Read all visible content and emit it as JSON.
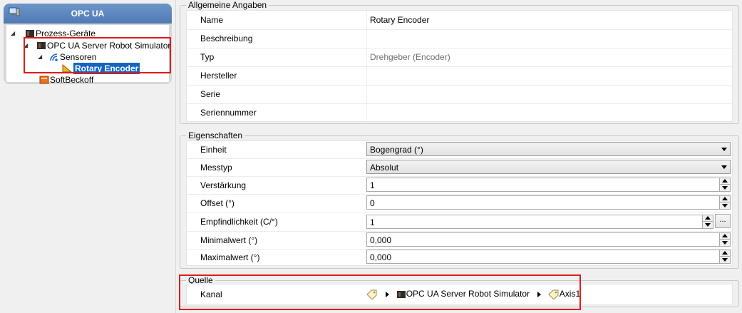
{
  "tree": {
    "header_title": "OPC UA",
    "nodes": [
      {
        "label": "Prozess-Geräte"
      },
      {
        "label": "OPC UA Server Robot Simulator"
      },
      {
        "label": "Sensoren"
      },
      {
        "label": "Rotary Encoder"
      },
      {
        "label": "SoftBeckoff"
      }
    ]
  },
  "allgemein": {
    "legend": "Allgemeine Angaben",
    "rows": [
      {
        "label": "Name",
        "value": "Rotary Encoder"
      },
      {
        "label": "Beschreibung",
        "value": ""
      },
      {
        "label": "Typ",
        "value": "Drehgeber (Encoder)"
      },
      {
        "label": "Hersteller",
        "value": ""
      },
      {
        "label": "Serie",
        "value": ""
      },
      {
        "label": "Seriennummer",
        "value": ""
      }
    ]
  },
  "eigenschaften": {
    "legend": "Eigenschaften",
    "rows": [
      {
        "label": "Einheit",
        "value": "Bogengrad (°)"
      },
      {
        "label": "Messtyp",
        "value": "Absolut"
      },
      {
        "label": "Verstärkung",
        "value": "1"
      },
      {
        "label": "Offset (°)",
        "value": "0"
      },
      {
        "label": "Empfindlichkeit (C/°)",
        "value": "1"
      },
      {
        "label": "Minimalwert (°)",
        "value": "0,000"
      },
      {
        "label": "Maximalwert (°)",
        "value": "0,000"
      }
    ],
    "ellipsis_label": "..."
  },
  "quelle": {
    "legend": "Quelle",
    "kanal_label": "Kanal",
    "path": [
      "OPC UA Server Robot Simulator",
      "Axis1"
    ]
  },
  "colors": {
    "selection": "#1565c0",
    "highlight_box": "#e01b1b",
    "header": "#5a84bd"
  }
}
